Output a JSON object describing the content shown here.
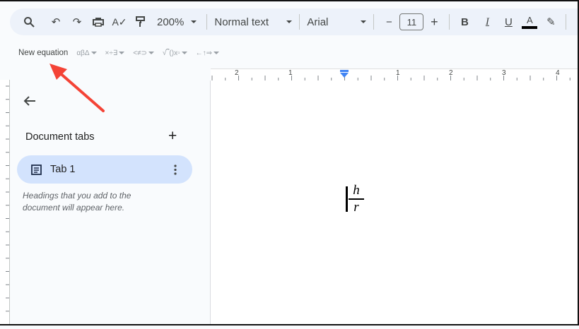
{
  "toolbar": {
    "zoom": "200%",
    "style": "Normal text",
    "font": "Arial",
    "font_size": "11",
    "bold": "B",
    "italic": "I",
    "underline": "U",
    "text_color": "A",
    "minus": "−",
    "plus": "+"
  },
  "equation_toolbar": {
    "new_equation": "New equation",
    "groups": [
      "αβΔ",
      "×÷∃",
      "<≠⊃",
      "√⎴()x▫",
      "←↑⇒"
    ]
  },
  "ruler": {
    "labels": [
      "2",
      "1",
      "1",
      "2",
      "3",
      "4"
    ]
  },
  "sidebar": {
    "title": "Document tabs",
    "add": "+",
    "tabs": [
      {
        "label": "Tab 1"
      }
    ],
    "hint": "Headings that you add to the document will appear here."
  },
  "document": {
    "equation": {
      "numerator": "h",
      "denominator": "r"
    }
  },
  "annotation": {
    "color": "#f44336"
  }
}
